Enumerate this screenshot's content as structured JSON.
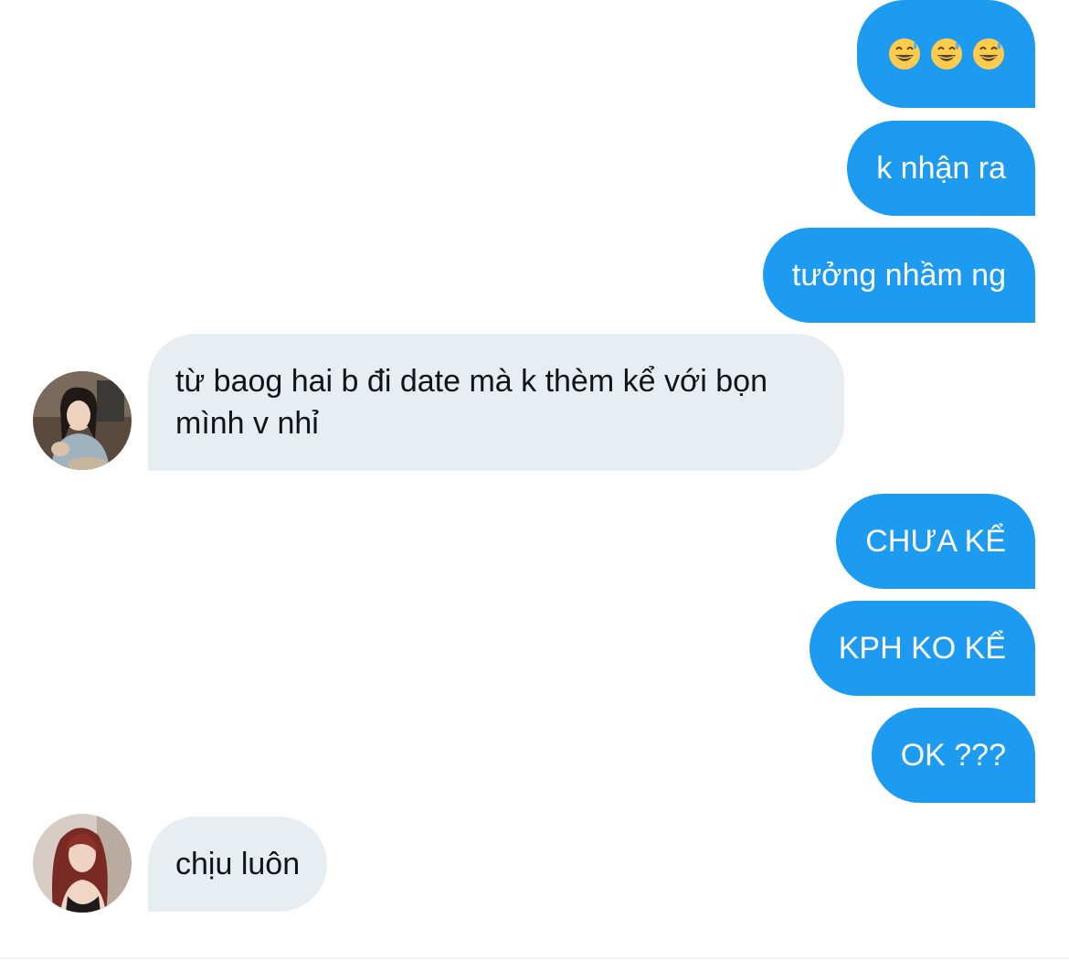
{
  "conversation": {
    "messages": [
      {
        "side": "sent",
        "type": "emoji",
        "icons": [
          "grinning-sweat-emoji",
          "grinning-sweat-emoji",
          "grinning-sweat-emoji"
        ]
      },
      {
        "side": "sent",
        "text": "k nhận ra"
      },
      {
        "side": "sent",
        "text": "tưởng nhầm ng"
      },
      {
        "side": "received",
        "text": "từ baog hai b đi date mà k thèm kể với bọn mình v nhỉ",
        "avatar": "avatar-icon-user-1"
      },
      {
        "side": "sent",
        "text": "CHƯA KỂ"
      },
      {
        "side": "sent",
        "text": "KPH KO KỂ"
      },
      {
        "side": "sent",
        "text": "OK ???"
      },
      {
        "side": "received",
        "text": "chịu luôn",
        "avatar": "avatar-icon-user-2"
      }
    ]
  },
  "colors": {
    "sent_bubble": "#1d9bf0",
    "received_bubble": "#e8edf1",
    "received_text": "#0f1419",
    "sent_text": "#ffffff"
  }
}
